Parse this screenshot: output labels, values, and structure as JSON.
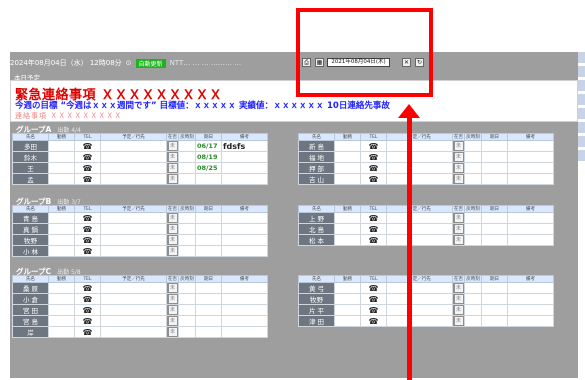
{
  "topbar": {
    "datetime": "2024年08月04日（水） 12時08分",
    "auto_update_label": "自動更新",
    "info_text": "NTT… … …  ……… …"
  },
  "date_picker": {
    "value": "2021年08月04日(木)",
    "close_label": "✕"
  },
  "section_label": "本日予定",
  "notice": {
    "title": "緊急連絡事項 ＸＸＸＸＸＸＸＸＸ",
    "goal": "今週の目標 “今週はｘｘｘ週間です” 目標値：ｘｘｘｘｘ 実績値：ｘｘｘｘｘｘ 10日連絡先事故",
    "sub": "連絡事項 ＸＸＸＸＸＸＸＸＸ"
  },
  "headers": [
    "氏名",
    "勤務",
    "TEL",
    "予定／行先",
    "在否",
    "戻時刻",
    "期日",
    "備考"
  ],
  "groups": {
    "a": {
      "title": "グループA",
      "sub": "出勤 4/4",
      "left_rows": [
        {
          "name": "多田",
          "date": "06/17",
          "note": "fdsfs"
        },
        {
          "name": "鈴木",
          "date": "08/19",
          "note": ""
        },
        {
          "name": "王",
          "date": "08/25",
          "note": ""
        },
        {
          "name": "孟",
          "date": "",
          "note": ""
        }
      ],
      "right_rows": [
        {
          "name": "新 島"
        },
        {
          "name": "福 地"
        },
        {
          "name": "押 部"
        },
        {
          "name": "吉 山"
        }
      ]
    },
    "b": {
      "title": "グループB",
      "sub": "出勤 3/7",
      "left_rows": [
        {
          "name": "青 島"
        },
        {
          "name": "真 鍋"
        },
        {
          "name": "牧野"
        },
        {
          "name": "小 林"
        }
      ],
      "right_rows": [
        {
          "name": "上 野"
        },
        {
          "name": "北 島"
        },
        {
          "name": "松 本"
        }
      ]
    },
    "c": {
      "title": "グループC",
      "sub": "出勤 5/8",
      "left_rows": [
        {
          "name": "桑 原"
        },
        {
          "name": "小 倉"
        },
        {
          "name": "宮 田"
        },
        {
          "name": "宮 島"
        },
        {
          "name": "岸"
        }
      ],
      "right_rows": [
        {
          "name": "黄 弓"
        },
        {
          "name": "牧野"
        },
        {
          "name": "片 平"
        },
        {
          "name": "津 田"
        }
      ]
    }
  },
  "icons": {
    "phone": "☎",
    "status": "未"
  },
  "colors": {
    "alert": "#e00000",
    "goal": "#2020ff",
    "highlight": "#ff0000",
    "panel": "#9e9e9e"
  }
}
